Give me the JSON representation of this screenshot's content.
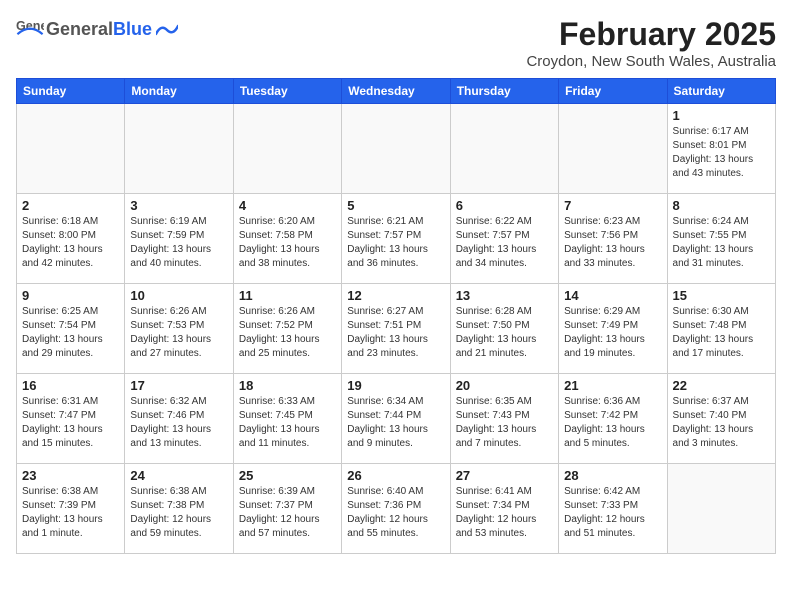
{
  "logo": {
    "general": "General",
    "blue": "Blue"
  },
  "header": {
    "month": "February 2025",
    "location": "Croydon, New South Wales, Australia"
  },
  "days_of_week": [
    "Sunday",
    "Monday",
    "Tuesday",
    "Wednesday",
    "Thursday",
    "Friday",
    "Saturday"
  ],
  "weeks": [
    [
      {
        "day": "",
        "info": ""
      },
      {
        "day": "",
        "info": ""
      },
      {
        "day": "",
        "info": ""
      },
      {
        "day": "",
        "info": ""
      },
      {
        "day": "",
        "info": ""
      },
      {
        "day": "",
        "info": ""
      },
      {
        "day": "1",
        "info": "Sunrise: 6:17 AM\nSunset: 8:01 PM\nDaylight: 13 hours and 43 minutes."
      }
    ],
    [
      {
        "day": "2",
        "info": "Sunrise: 6:18 AM\nSunset: 8:00 PM\nDaylight: 13 hours and 42 minutes."
      },
      {
        "day": "3",
        "info": "Sunrise: 6:19 AM\nSunset: 7:59 PM\nDaylight: 13 hours and 40 minutes."
      },
      {
        "day": "4",
        "info": "Sunrise: 6:20 AM\nSunset: 7:58 PM\nDaylight: 13 hours and 38 minutes."
      },
      {
        "day": "5",
        "info": "Sunrise: 6:21 AM\nSunset: 7:57 PM\nDaylight: 13 hours and 36 minutes."
      },
      {
        "day": "6",
        "info": "Sunrise: 6:22 AM\nSunset: 7:57 PM\nDaylight: 13 hours and 34 minutes."
      },
      {
        "day": "7",
        "info": "Sunrise: 6:23 AM\nSunset: 7:56 PM\nDaylight: 13 hours and 33 minutes."
      },
      {
        "day": "8",
        "info": "Sunrise: 6:24 AM\nSunset: 7:55 PM\nDaylight: 13 hours and 31 minutes."
      }
    ],
    [
      {
        "day": "9",
        "info": "Sunrise: 6:25 AM\nSunset: 7:54 PM\nDaylight: 13 hours and 29 minutes."
      },
      {
        "day": "10",
        "info": "Sunrise: 6:26 AM\nSunset: 7:53 PM\nDaylight: 13 hours and 27 minutes."
      },
      {
        "day": "11",
        "info": "Sunrise: 6:26 AM\nSunset: 7:52 PM\nDaylight: 13 hours and 25 minutes."
      },
      {
        "day": "12",
        "info": "Sunrise: 6:27 AM\nSunset: 7:51 PM\nDaylight: 13 hours and 23 minutes."
      },
      {
        "day": "13",
        "info": "Sunrise: 6:28 AM\nSunset: 7:50 PM\nDaylight: 13 hours and 21 minutes."
      },
      {
        "day": "14",
        "info": "Sunrise: 6:29 AM\nSunset: 7:49 PM\nDaylight: 13 hours and 19 minutes."
      },
      {
        "day": "15",
        "info": "Sunrise: 6:30 AM\nSunset: 7:48 PM\nDaylight: 13 hours and 17 minutes."
      }
    ],
    [
      {
        "day": "16",
        "info": "Sunrise: 6:31 AM\nSunset: 7:47 PM\nDaylight: 13 hours and 15 minutes."
      },
      {
        "day": "17",
        "info": "Sunrise: 6:32 AM\nSunset: 7:46 PM\nDaylight: 13 hours and 13 minutes."
      },
      {
        "day": "18",
        "info": "Sunrise: 6:33 AM\nSunset: 7:45 PM\nDaylight: 13 hours and 11 minutes."
      },
      {
        "day": "19",
        "info": "Sunrise: 6:34 AM\nSunset: 7:44 PM\nDaylight: 13 hours and 9 minutes."
      },
      {
        "day": "20",
        "info": "Sunrise: 6:35 AM\nSunset: 7:43 PM\nDaylight: 13 hours and 7 minutes."
      },
      {
        "day": "21",
        "info": "Sunrise: 6:36 AM\nSunset: 7:42 PM\nDaylight: 13 hours and 5 minutes."
      },
      {
        "day": "22",
        "info": "Sunrise: 6:37 AM\nSunset: 7:40 PM\nDaylight: 13 hours and 3 minutes."
      }
    ],
    [
      {
        "day": "23",
        "info": "Sunrise: 6:38 AM\nSunset: 7:39 PM\nDaylight: 13 hours and 1 minute."
      },
      {
        "day": "24",
        "info": "Sunrise: 6:38 AM\nSunset: 7:38 PM\nDaylight: 12 hours and 59 minutes."
      },
      {
        "day": "25",
        "info": "Sunrise: 6:39 AM\nSunset: 7:37 PM\nDaylight: 12 hours and 57 minutes."
      },
      {
        "day": "26",
        "info": "Sunrise: 6:40 AM\nSunset: 7:36 PM\nDaylight: 12 hours and 55 minutes."
      },
      {
        "day": "27",
        "info": "Sunrise: 6:41 AM\nSunset: 7:34 PM\nDaylight: 12 hours and 53 minutes."
      },
      {
        "day": "28",
        "info": "Sunrise: 6:42 AM\nSunset: 7:33 PM\nDaylight: 12 hours and 51 minutes."
      },
      {
        "day": "",
        "info": ""
      }
    ]
  ]
}
